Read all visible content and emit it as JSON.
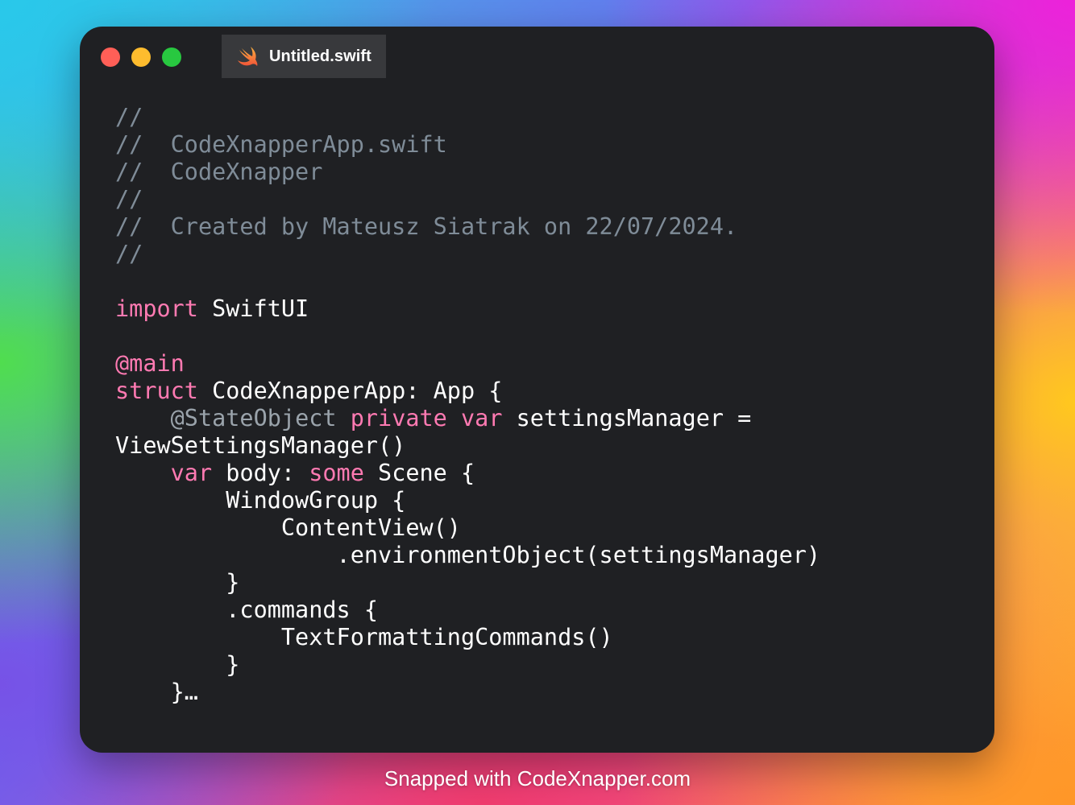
{
  "window": {
    "controls": {
      "close_color": "#ff5f57",
      "minimize_color": "#febc2e",
      "zoom_color": "#28c840"
    },
    "tab": {
      "icon": "swift-icon",
      "label": "Untitled.swift"
    }
  },
  "editor": {
    "lines": [
      [
        {
          "t": "//",
          "k": "comment"
        }
      ],
      [
        {
          "t": "//  CodeXnapperApp.swift",
          "k": "comment"
        }
      ],
      [
        {
          "t": "//  CodeXnapper",
          "k": "comment"
        }
      ],
      [
        {
          "t": "//",
          "k": "comment"
        }
      ],
      [
        {
          "t": "//  Created by Mateusz Siatrak on 22/07/2024.",
          "k": "comment"
        }
      ],
      [
        {
          "t": "//",
          "k": "comment"
        }
      ],
      [],
      [
        {
          "t": "import",
          "k": "keyword"
        },
        {
          "t": " SwiftUI",
          "k": "plain"
        }
      ],
      [],
      [
        {
          "t": "@main",
          "k": "attr-kw"
        }
      ],
      [
        {
          "t": "struct",
          "k": "keyword"
        },
        {
          "t": " CodeXnapperApp: App {",
          "k": "plain"
        }
      ],
      [
        {
          "t": "    ",
          "k": "plain"
        },
        {
          "t": "@StateObject",
          "k": "attr-dim"
        },
        {
          "t": " ",
          "k": "plain"
        },
        {
          "t": "private",
          "k": "keyword"
        },
        {
          "t": " ",
          "k": "plain"
        },
        {
          "t": "var",
          "k": "keyword"
        },
        {
          "t": " settingsManager =",
          "k": "plain"
        }
      ],
      [
        {
          "t": "ViewSettingsManager()",
          "k": "plain"
        }
      ],
      [
        {
          "t": "    ",
          "k": "plain"
        },
        {
          "t": "var",
          "k": "keyword"
        },
        {
          "t": " body: ",
          "k": "plain"
        },
        {
          "t": "some",
          "k": "keyword"
        },
        {
          "t": " Scene {",
          "k": "plain"
        }
      ],
      [
        {
          "t": "        WindowGroup {",
          "k": "plain"
        }
      ],
      [
        {
          "t": "            ContentView()",
          "k": "plain"
        }
      ],
      [
        {
          "t": "                .environmentObject(settingsManager)",
          "k": "plain"
        }
      ],
      [
        {
          "t": "        }",
          "k": "plain"
        }
      ],
      [
        {
          "t": "        .commands {",
          "k": "plain"
        }
      ],
      [
        {
          "t": "            TextFormattingCommands()",
          "k": "plain"
        }
      ],
      [
        {
          "t": "        }",
          "k": "plain"
        }
      ],
      [
        {
          "t": "    }…",
          "k": "plain"
        }
      ]
    ]
  },
  "footer": {
    "text": "Snapped with CodeXnapper.com"
  }
}
